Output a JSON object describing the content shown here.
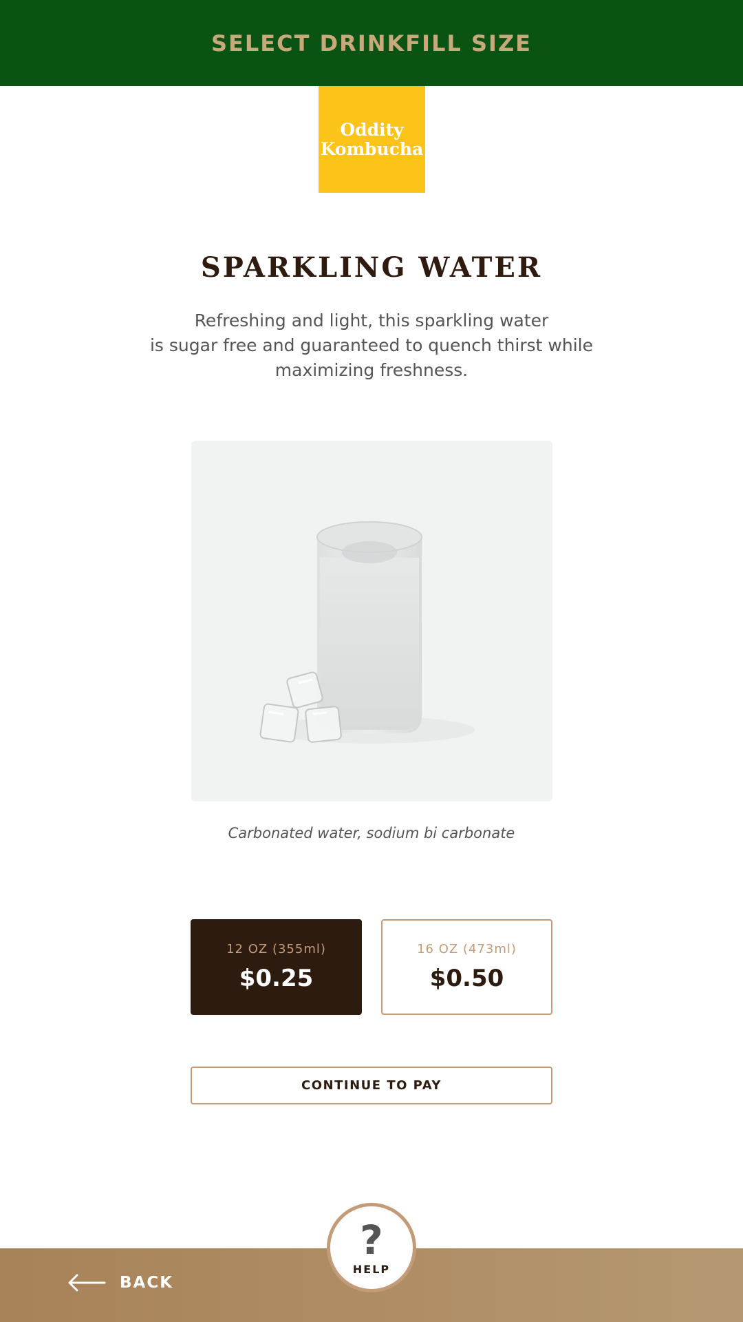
{
  "header": {
    "title": "SELECT DRINKFILL SIZE"
  },
  "logo": {
    "line1": "Oddity",
    "line2": "Kombucha"
  },
  "product": {
    "name": "SPARKLING WATER",
    "description_lines": [
      "Refreshing and light, this sparkling water",
      "is sugar free and guaranteed to quench thirst while",
      "maximizing freshness."
    ],
    "image_icon": "glass-with-ice-icon",
    "ingredients": "Carbonated water, sodium bi carbonate"
  },
  "sizes": [
    {
      "label": "12 OZ (355ml)",
      "price": "$0.25",
      "selected": true
    },
    {
      "label": "16 OZ (473ml)",
      "price": "$0.50",
      "selected": false
    }
  ],
  "actions": {
    "continue_label": "CONTINUE TO PAY",
    "back_label": "BACK",
    "back_icon": "arrow-left-icon",
    "help_icon": "question-mark-icon",
    "help_glyph": "?",
    "help_label": "HELP"
  },
  "colors": {
    "header_bg": "#0b5313",
    "header_text": "#c7a97c",
    "logo_bg": "#fcc419",
    "selected_bg": "#2d1b10",
    "accent_border": "#c49b79",
    "footer_bg": "#a88258"
  }
}
